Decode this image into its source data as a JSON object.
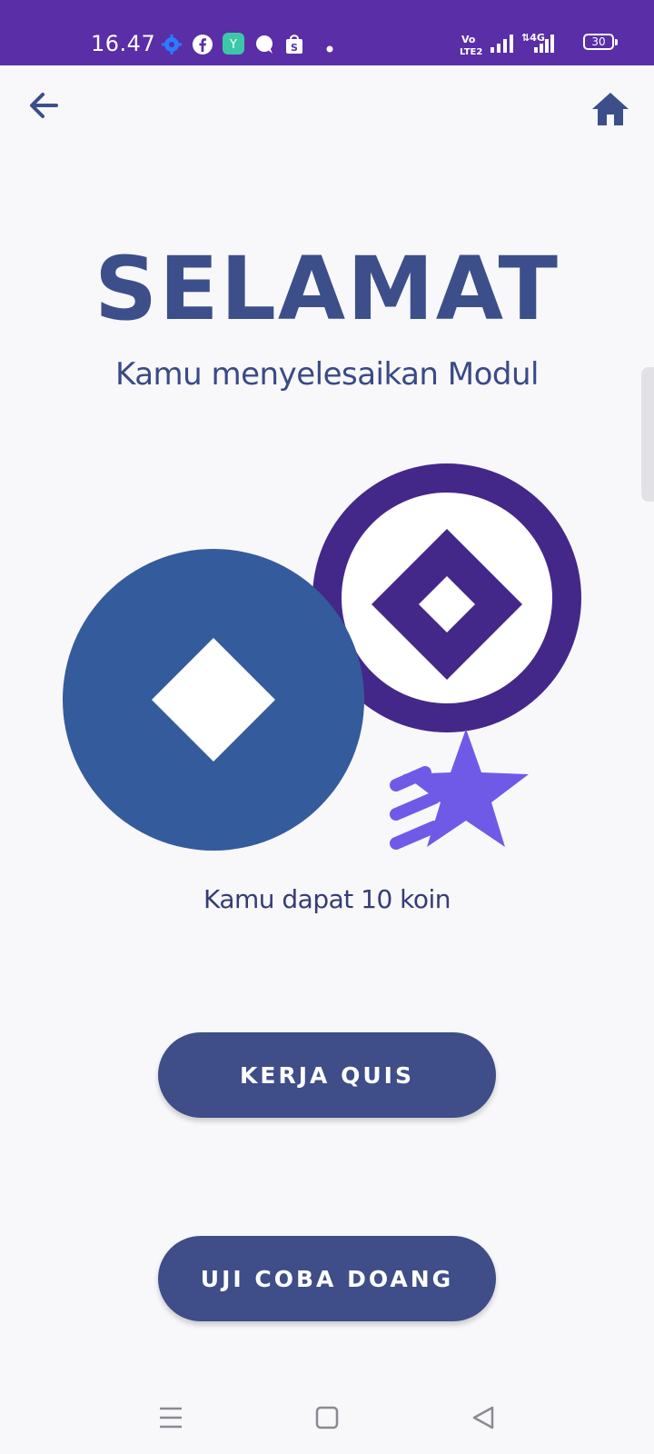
{
  "status_bar": {
    "time": "16.47",
    "battery": "30",
    "color": "#5a2ea6",
    "left_icons": [
      "settings-gear-icon",
      "facebook-icon",
      "app-notification-icon",
      "chat-bubble-icon",
      "shopping-bag-icon",
      "more-dot-icon"
    ],
    "right_icons": [
      "volte-icon",
      "signal-icon",
      "4g-signal-icon",
      "battery-icon"
    ]
  },
  "top_bar": {
    "back_icon": "arrow-left-icon",
    "home_icon": "home-icon"
  },
  "content": {
    "title": "SELAMAT",
    "subtitle": "Kamu menyelesaikan Modul",
    "coins_text": "Kamu dapat 10 koin"
  },
  "buttons": {
    "quiz": "KERJA QUIS",
    "trial": "UJI COBA DOANG"
  },
  "nav_bar": {
    "icons": [
      "menu-icon",
      "home-square-icon",
      "back-triangle-icon"
    ]
  },
  "colors": {
    "primary": "#3f4d88",
    "coin_blue": "#345b9c",
    "coin_purple": "#43288a",
    "star": "#6f5ae8",
    "background": "#f8f8fa"
  }
}
